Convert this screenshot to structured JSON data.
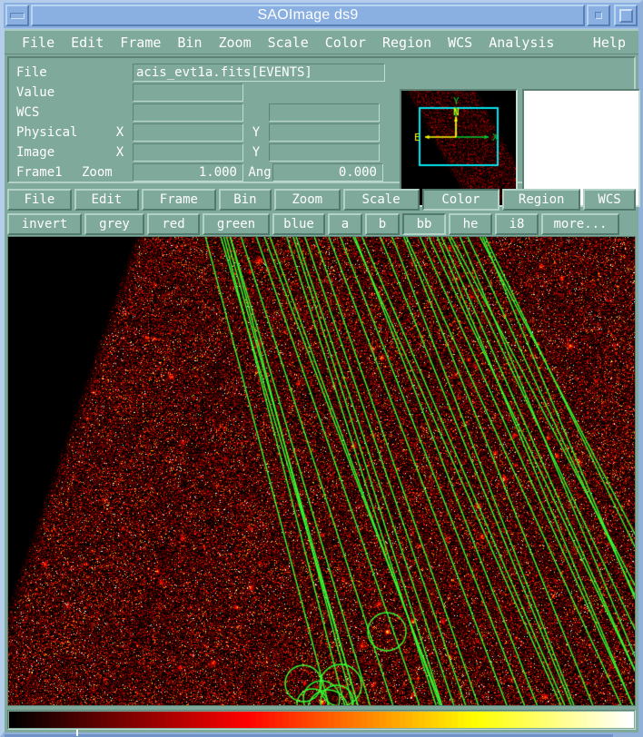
{
  "window": {
    "title": "SAOImage ds9",
    "minimize_label": "minimize",
    "iconify_label": "iconify",
    "maximize_label": "maximize"
  },
  "menubar": {
    "items": [
      {
        "label": "File"
      },
      {
        "label": "Edit"
      },
      {
        "label": "Frame"
      },
      {
        "label": "Bin"
      },
      {
        "label": "Zoom"
      },
      {
        "label": "Scale"
      },
      {
        "label": "Color"
      },
      {
        "label": "Region"
      },
      {
        "label": "WCS"
      },
      {
        "label": "Analysis"
      }
    ],
    "help": "Help"
  },
  "info_panel": {
    "rows": [
      {
        "label": "File",
        "value": "acis_evt1a.fits[EVENTS]"
      },
      {
        "label": "Value",
        "value": ""
      },
      {
        "label": "WCS",
        "value": "",
        "value2": ""
      },
      {
        "label": "Physical",
        "x_label": "X",
        "value": "",
        "y_label": "Y",
        "value2": ""
      },
      {
        "label": "Image",
        "x_label": "X",
        "value": "",
        "y_label": "Y",
        "value2": ""
      }
    ],
    "frame_label": "Frame1",
    "zoom_label": "Zoom",
    "zoom_value": "1.000",
    "ang_label": "Ang",
    "ang_value": "0.000"
  },
  "panner": {
    "axis_x_label": "X",
    "axis_y_label": "Y",
    "wcs_n_label": "N",
    "wcs_e_label": "E",
    "axis_color": "#00cc33",
    "wcs_color": "#ffff00",
    "viewport_color": "#00e5ee"
  },
  "magnifier": {
    "background": "#ffffff"
  },
  "buttonbar_main": {
    "buttons": [
      {
        "label": "File",
        "selected": false
      },
      {
        "label": "Edit",
        "selected": false
      },
      {
        "label": "Frame",
        "selected": false
      },
      {
        "label": "Bin",
        "selected": false
      },
      {
        "label": "Zoom",
        "selected": false
      },
      {
        "label": "Scale",
        "selected": false
      },
      {
        "label": "Color",
        "selected": true
      },
      {
        "label": "Region",
        "selected": false
      },
      {
        "label": "WCS",
        "selected": false
      }
    ]
  },
  "buttonbar_color": {
    "buttons": [
      {
        "label": "invert",
        "selected": false
      },
      {
        "label": "grey",
        "selected": false
      },
      {
        "label": "red",
        "selected": false
      },
      {
        "label": "green",
        "selected": false
      },
      {
        "label": "blue",
        "selected": false
      },
      {
        "label": "a",
        "selected": false
      },
      {
        "label": "b",
        "selected": false
      },
      {
        "label": "bb",
        "selected": true
      },
      {
        "label": "he",
        "selected": false
      },
      {
        "label": "i8",
        "selected": false
      },
      {
        "label": "more...",
        "selected": false
      }
    ]
  },
  "image": {
    "colormap": "bb",
    "region_color": "#33ff33",
    "background": "#000000",
    "chip_tint": "#7a1200",
    "description": "Chandra ACIS event-1a X-ray image with green region overlay of many near-parallel line regions and circle regions"
  },
  "colorbar": {
    "colormap": "bb",
    "stops": [
      "#000000",
      "#3a0000",
      "#7a1500",
      "#c84000",
      "#f08000",
      "#ffc020",
      "#ffe880",
      "#ffffff"
    ]
  }
}
